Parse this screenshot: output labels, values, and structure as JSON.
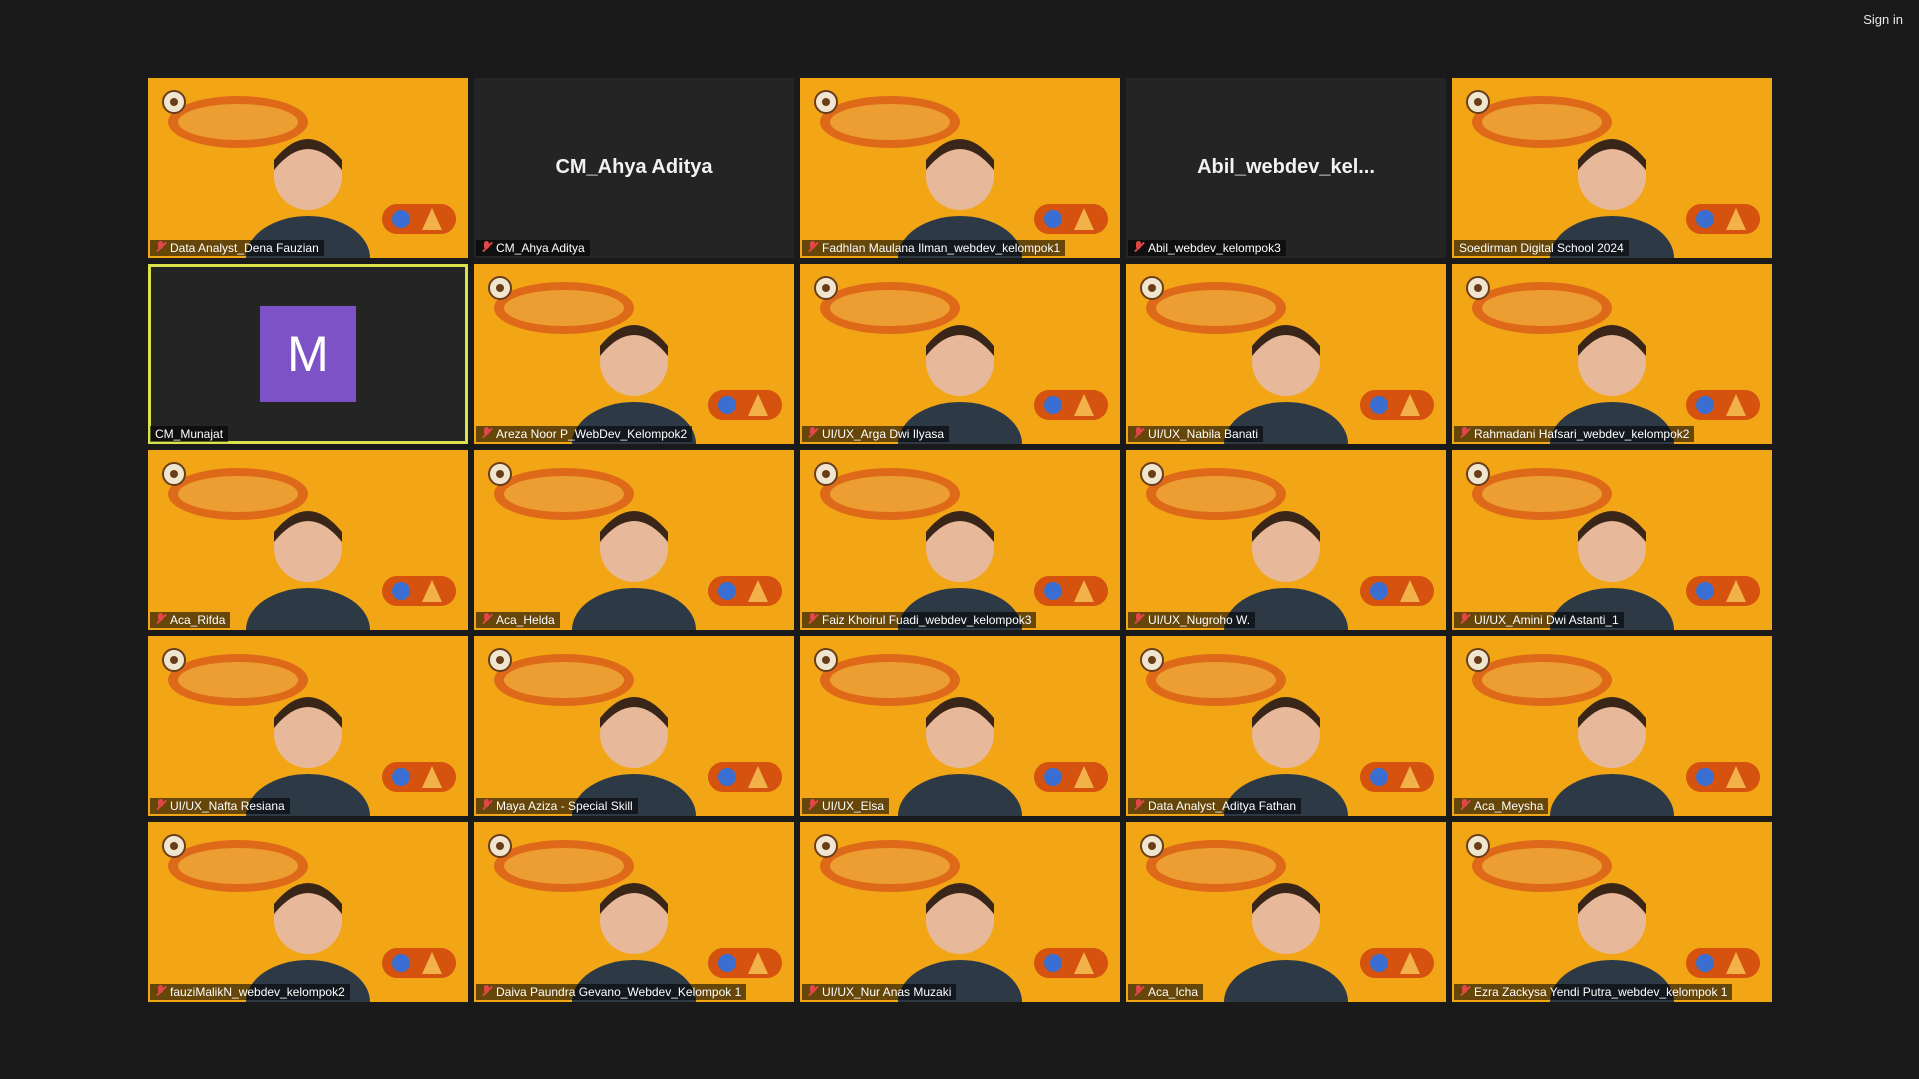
{
  "header": {
    "sign_in_label": "Sign in"
  },
  "colors": {
    "tile_bg": "#f2a616",
    "tile_dark": "#242424",
    "active_border": "#d9e24a",
    "avatar_bg": "#7d52c6",
    "muted_mic": "#e04848"
  },
  "participants": [
    {
      "name": "Data Analyst_Dena Fauzian",
      "muted": true,
      "video": "avatar"
    },
    {
      "name": "CM_Ahya Aditya",
      "muted": true,
      "video": "off",
      "center_text": "CM_Ahya Aditya"
    },
    {
      "name": "Fadhlan Maulana Ilman_webdev_kelompok1",
      "muted": true,
      "video": "camera"
    },
    {
      "name": "Abil_webdev_kelompok3",
      "muted": true,
      "video": "off",
      "center_text": "Abil_webdev_kel..."
    },
    {
      "name": "Soedirman Digital School 2024",
      "muted": false,
      "video": "camera"
    },
    {
      "name": "CM_Munajat",
      "muted": false,
      "video": "off",
      "avatar_letter": "M",
      "active": true
    },
    {
      "name": "Areza Noor P_WebDev_Kelompok2",
      "muted": true,
      "video": "camera"
    },
    {
      "name": "UI/UX_Arga Dwi Ilyasa",
      "muted": true,
      "video": "camera"
    },
    {
      "name": "UI/UX_Nabila Banati",
      "muted": true,
      "video": "camera"
    },
    {
      "name": "Rahmadani Hafsari_webdev_kelompok2",
      "muted": true,
      "video": "camera"
    },
    {
      "name": "Aca_Rifda",
      "muted": true,
      "video": "camera"
    },
    {
      "name": "Aca_Helda",
      "muted": true,
      "video": "camera"
    },
    {
      "name": "Faiz Khoirul Fuadi_webdev_kelompok3",
      "muted": true,
      "video": "camera"
    },
    {
      "name": "UI/UX_Nugroho W.",
      "muted": true,
      "video": "avatar"
    },
    {
      "name": "UI/UX_Amini Dwi Astanti_1",
      "muted": true,
      "video": "avatar"
    },
    {
      "name": "UI/UX_Nafta Resiana",
      "muted": true,
      "video": "avatar"
    },
    {
      "name": "Maya Aziza - Special Skill",
      "muted": true,
      "video": "avatar"
    },
    {
      "name": "UI/UX_Elsa",
      "muted": true,
      "video": "avatar"
    },
    {
      "name": "Data Analyst_Aditya Fathan",
      "muted": true,
      "video": "avatar"
    },
    {
      "name": "Aca_Meysha",
      "muted": true,
      "video": "camera"
    },
    {
      "name": "fauziMalikN_webdev_kelompok2",
      "muted": true,
      "video": "avatar"
    },
    {
      "name": "Daiva Paundra Gevano_Webdev_Kelompok 1",
      "muted": true,
      "video": "camera"
    },
    {
      "name": "UI/UX_Nur Anas Muzaki",
      "muted": true,
      "video": "camera"
    },
    {
      "name": "Aca_Icha",
      "muted": true,
      "video": "camera"
    },
    {
      "name": "Ezra Zackysa Yendi Putra_webdev_kelompok 1",
      "muted": true,
      "video": "avatar"
    }
  ]
}
